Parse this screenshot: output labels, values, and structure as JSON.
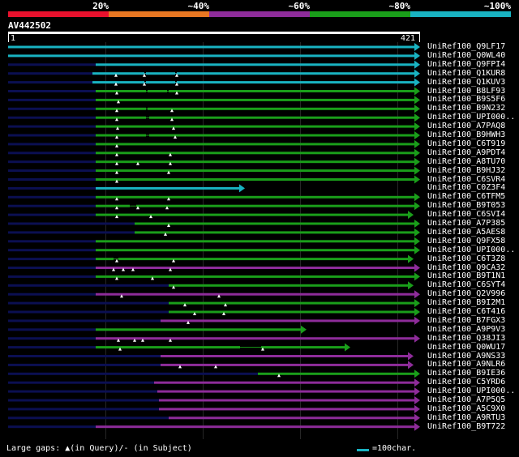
{
  "scale": {
    "labels": [
      "20%",
      "~40%",
      "~60%",
      "~80%",
      "~100%"
    ],
    "colors": [
      "#e8112d",
      "#e87722",
      "#8e2c9a",
      "#1a9e1a",
      "#19b3c2"
    ]
  },
  "query": {
    "title": "AV442502",
    "start": "1",
    "end": "421"
  },
  "colors": {
    "cyan": "#19b3c2",
    "green": "#1a9e1a",
    "magenta": "#8e2c9a",
    "navy": "#0b0f52",
    "mark": "#ffffff"
  },
  "hits": [
    {
      "label": "UniRef100_Q9LF17",
      "color": "cyan"
    },
    {
      "label": "UniRef100_Q0WL40",
      "color": "cyan"
    },
    {
      "label": "UniRef100_Q9FPI4",
      "color": "cyan"
    },
    {
      "label": "UniRef100_Q1KUR8",
      "color": "cyan"
    },
    {
      "label": "UniRef100_Q1KUV3",
      "color": "cyan"
    },
    {
      "label": "UniRef100_B8LF93",
      "color": "green"
    },
    {
      "label": "UniRef100_B9S5F6",
      "color": "green"
    },
    {
      "label": "UniRef100_B9N232",
      "color": "green"
    },
    {
      "label": "UniRef100_UPI000..",
      "color": "green"
    },
    {
      "label": "UniRef100_A7PAQ8",
      "color": "green"
    },
    {
      "label": "UniRef100_B9HWH3",
      "color": "green"
    },
    {
      "label": "UniRef100_C6T919",
      "color": "green"
    },
    {
      "label": "UniRef100_A9PDT4",
      "color": "green"
    },
    {
      "label": "UniRef100_A8TU70",
      "color": "green"
    },
    {
      "label": "UniRef100_B9HJ32",
      "color": "green"
    },
    {
      "label": "UniRef100_C6SVR4",
      "color": "green"
    },
    {
      "label": "UniRef100_C0Z3F4",
      "color": "cyan"
    },
    {
      "label": "UniRef100_C6TFM5",
      "color": "green"
    },
    {
      "label": "UniRef100_B9T053",
      "color": "green"
    },
    {
      "label": "UniRef100_C6SVI4",
      "color": "green"
    },
    {
      "label": "UniRef100_A7P385",
      "color": "green"
    },
    {
      "label": "UniRef100_A5AES8",
      "color": "green"
    },
    {
      "label": "UniRef100_Q9FX58",
      "color": "green"
    },
    {
      "label": "UniRef100_UPI000..",
      "color": "green"
    },
    {
      "label": "UniRef100_C6T3Z8",
      "color": "green"
    },
    {
      "label": "UniRef100_Q9CA32",
      "color": "magenta"
    },
    {
      "label": "UniRef100_B9T1N1",
      "color": "green"
    },
    {
      "label": "UniRef100_C6SYT4",
      "color": "green"
    },
    {
      "label": "UniRef100_Q2V996",
      "color": "magenta"
    },
    {
      "label": "UniRef100_B9I2M1",
      "color": "green"
    },
    {
      "label": "UniRef100_C6T416",
      "color": "green"
    },
    {
      "label": "UniRef100_B7FGX3",
      "color": "magenta"
    },
    {
      "label": "UniRef100_A9P9V3",
      "color": "green"
    },
    {
      "label": "UniRef100_Q38JI3",
      "color": "magenta"
    },
    {
      "label": "UniRef100_Q0WU17",
      "color": "green"
    },
    {
      "label": "UniRef100_A9NS33",
      "color": "magenta"
    },
    {
      "label": "UniRef100_A9NLR6",
      "color": "magenta"
    },
    {
      "label": "UniRef100_B9IE36",
      "color": "green"
    },
    {
      "label": "UniRef100_C5YRD6",
      "color": "magenta"
    },
    {
      "label": "UniRef100_UPI000..",
      "color": "magenta"
    },
    {
      "label": "UniRef100_A7P5Q5",
      "color": "magenta"
    },
    {
      "label": "UniRef100_A5C9X0",
      "color": "magenta"
    },
    {
      "label": "UniRef100_A9RTU3",
      "color": "magenta"
    },
    {
      "label": "UniRef100_B9T722",
      "color": "magenta"
    }
  ],
  "footer": {
    "note": "Large gaps: ▲(in Query)/- (in Subject)",
    "legend": "=100char."
  }
}
